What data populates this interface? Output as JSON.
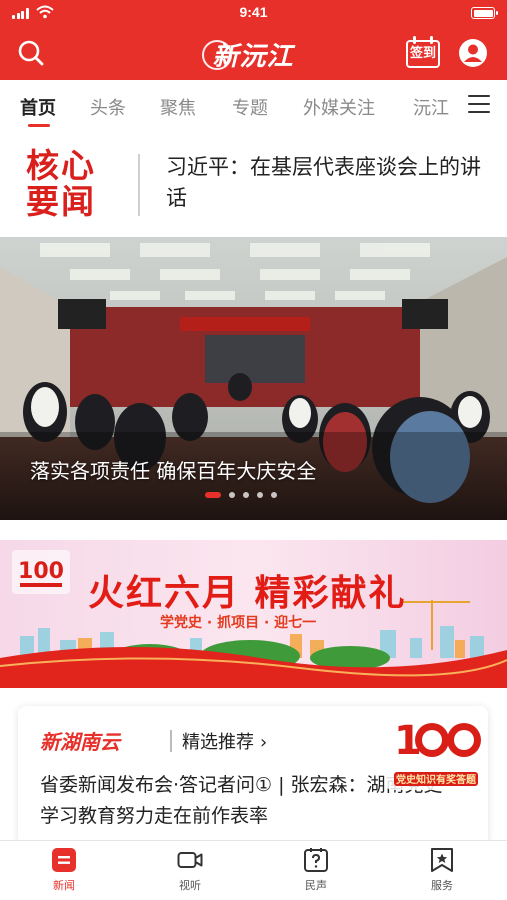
{
  "status_bar": {
    "time": "9:41"
  },
  "header": {
    "logo": "新沅江",
    "signin_label": "签到"
  },
  "tabs": [
    {
      "label": "首页",
      "active": true
    },
    {
      "label": "头条"
    },
    {
      "label": "聚焦"
    },
    {
      "label": "专题"
    },
    {
      "label": "外媒关注"
    },
    {
      "label": "沅江"
    }
  ],
  "headline": {
    "label_line1": "核心",
    "label_line2": "要闻",
    "title": "习近平：在基层代表座谈会上的讲话"
  },
  "carousel": {
    "caption": "落实各项责任 确保百年大庆安全",
    "slide_count": 5,
    "active_index": 0
  },
  "promo": {
    "title": "火红六月 精彩献礼",
    "subtitle": "学党史 · 抓项目 · 迎七一"
  },
  "card": {
    "brand": "新湖南云",
    "recommend_label": "精选推荐",
    "text": "省委新闻发布会·答记者问① | 张宏森：湖南党史学习教育努力走在前作表率",
    "badge_caption": "党史知识有奖答题"
  },
  "bottom_nav": [
    {
      "label": "新闻",
      "active": true
    },
    {
      "label": "视听"
    },
    {
      "label": "民声"
    },
    {
      "label": "服务"
    }
  ],
  "colors": {
    "brand_red": "#e8302b",
    "text": "#222222",
    "inactive_tab": "#8a8a8a"
  }
}
